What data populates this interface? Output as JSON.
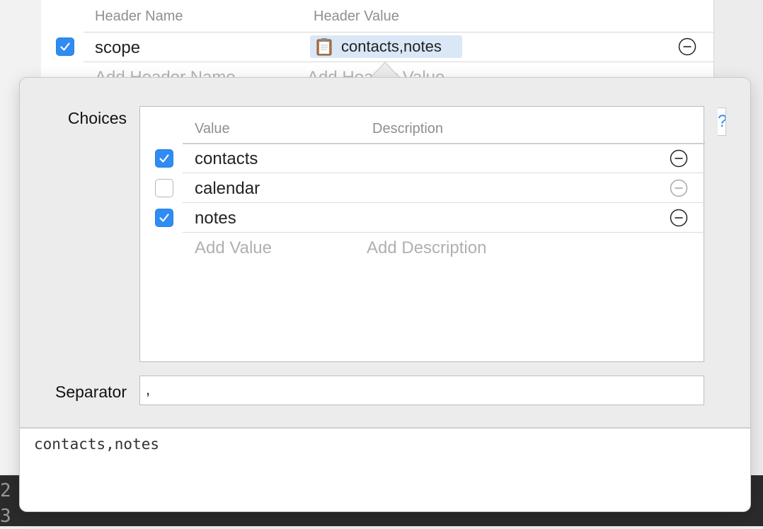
{
  "headers_table": {
    "columns": {
      "name": "Header Name",
      "value": "Header Value"
    },
    "rows": [
      {
        "enabled": true,
        "name": "scope",
        "value": "contacts,notes"
      }
    ],
    "add_name_placeholder": "Add Header Name",
    "add_value_placeholder": "Add Header Value"
  },
  "background": {
    "line_numbers": [
      "2",
      "3"
    ]
  },
  "popover": {
    "choices_label": "Choices",
    "help_glyph": "?",
    "choices": {
      "columns": {
        "value": "Value",
        "description": "Description"
      },
      "items": [
        {
          "checked": true,
          "value": "contacts",
          "description": ""
        },
        {
          "checked": false,
          "value": "calendar",
          "description": ""
        },
        {
          "checked": true,
          "value": "notes",
          "description": ""
        }
      ],
      "add_value_placeholder": "Add Value",
      "add_description_placeholder": "Add Description"
    },
    "separator_label": "Separator",
    "separator_value": ",",
    "preview_value": "contacts,notes"
  },
  "colors": {
    "accent": "#2f8cf2",
    "token_bg": "#d9e7f6"
  },
  "icons": {
    "checkbox_checked": "checkmark-icon",
    "remove": "minus-circle-icon",
    "clipboard": "clipboard-icon",
    "help": "help-icon"
  }
}
